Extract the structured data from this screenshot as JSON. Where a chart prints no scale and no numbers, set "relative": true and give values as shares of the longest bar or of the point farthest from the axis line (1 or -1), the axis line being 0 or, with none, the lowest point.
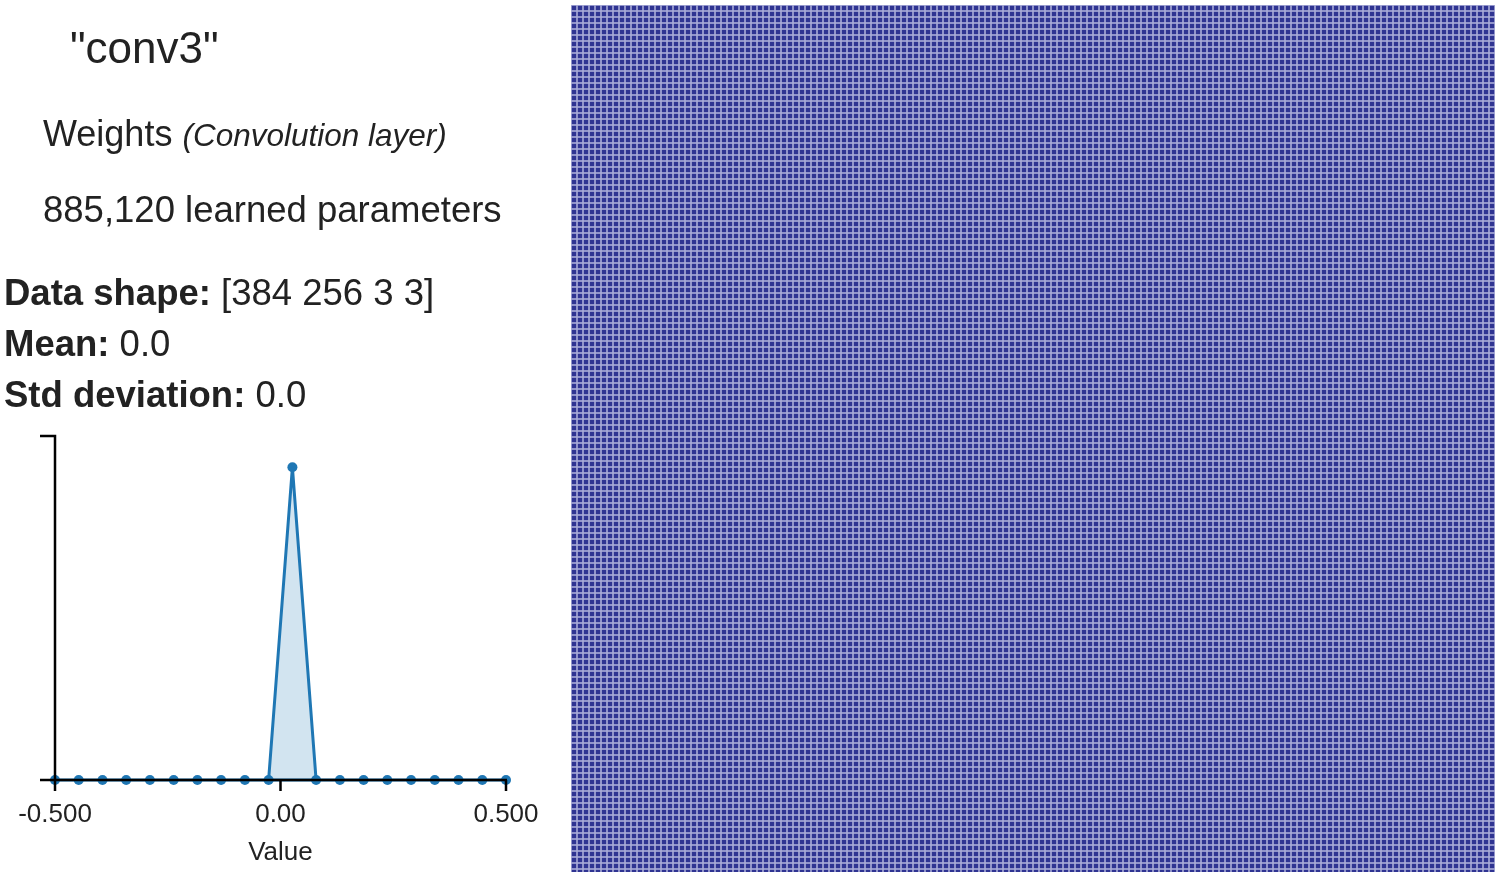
{
  "layer_title": "\"conv3\"",
  "blob": {
    "name": "Weights",
    "layer_type": "(Convolution layer)"
  },
  "parameter_count": "885,120 learned parameters",
  "stats": [
    {
      "label": "Data shape:",
      "value": "[384 256 3 3]"
    },
    {
      "label": "Mean:",
      "value": "0.0"
    },
    {
      "label": "Std deviation:",
      "value": "0.0"
    }
  ],
  "histogram": {
    "chart_data": {
      "type": "area",
      "xlabel": "Value",
      "relative": true,
      "x": [
        -0.5,
        -0.4474,
        -0.3947,
        -0.3421,
        -0.2895,
        -0.2368,
        -0.1842,
        -0.1316,
        -0.0789,
        -0.0263,
        0.0263,
        0.0789,
        0.1316,
        0.1842,
        0.2368,
        0.2895,
        0.3421,
        0.3947,
        0.4474,
        0.5
      ],
      "series": [
        {
          "color": "#1f77b4",
          "values": [
            0,
            0,
            0,
            0,
            0,
            0,
            0,
            0,
            0,
            0,
            1,
            0,
            0,
            0,
            0,
            0,
            0,
            0,
            0,
            0
          ]
        }
      ],
      "xlim": [
        -0.5,
        0.5
      ],
      "xticks": [
        {
          "value": -0.5,
          "label": "-0.500"
        },
        {
          "value": 0,
          "label": "0.00"
        },
        {
          "value": 0.5,
          "label": "0.500"
        }
      ]
    }
  }
}
